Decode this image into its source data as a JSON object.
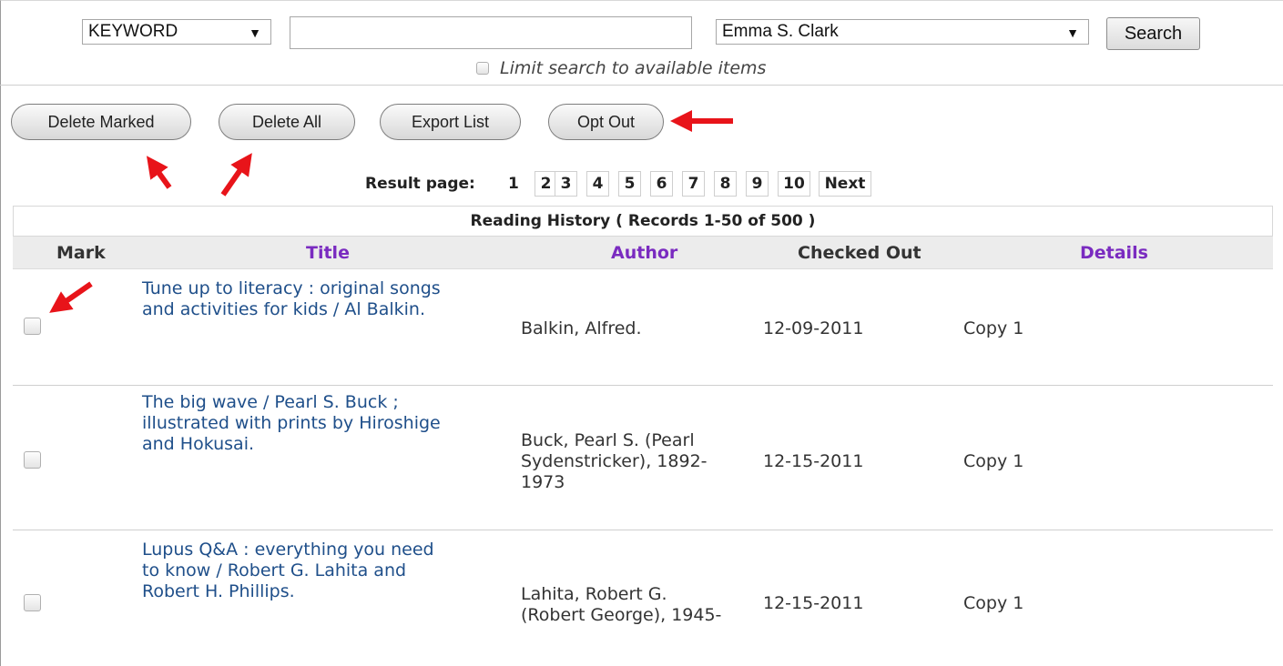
{
  "search": {
    "field_select": "KEYWORD",
    "query_value": "",
    "library_select": "Emma S. Clark",
    "search_label": "Search",
    "limit_label": "Limit search to available items"
  },
  "actions": {
    "delete_marked": "Delete Marked",
    "delete_all": "Delete All",
    "export_list": "Export List",
    "opt_out": "Opt Out"
  },
  "pagination": {
    "label": "Result page:",
    "current": "1",
    "pages": [
      "2",
      "3",
      "4",
      "5",
      "6",
      "7",
      "8",
      "9",
      "10"
    ],
    "next_label": "Next"
  },
  "table": {
    "caption": "Reading History ( Records 1-50 of 500 )",
    "headers": {
      "mark": "Mark",
      "title": "Title",
      "author": "Author",
      "checked_out": "Checked Out",
      "details": "Details"
    },
    "rows": [
      {
        "title_lines": [
          "Tune up to literacy : original songs",
          "and activities for kids / Al Balkin."
        ],
        "author_lines": [
          "Balkin, Alfred."
        ],
        "checked_out": "12-09-2011",
        "details": "Copy 1"
      },
      {
        "title_lines": [
          "The big wave / Pearl S. Buck ;",
          "illustrated with prints by Hiroshige",
          "and Hokusai."
        ],
        "author_lines": [
          "Buck, Pearl S. (Pearl",
          "Sydenstricker), 1892-",
          "1973"
        ],
        "checked_out": "12-15-2011",
        "details": "Copy 1"
      },
      {
        "title_lines": [
          "Lupus Q&A : everything you need",
          "to know / Robert G. Lahita and",
          "Robert H. Phillips."
        ],
        "author_lines": [
          "Lahita, Robert G.",
          "(Robert George), 1945-"
        ],
        "checked_out": "12-15-2011",
        "details": "Copy 1"
      }
    ]
  },
  "colors": {
    "annotation_arrow": "#e8141a",
    "header_link": "#7a2bc0",
    "title_link": "#1f4f8a"
  }
}
